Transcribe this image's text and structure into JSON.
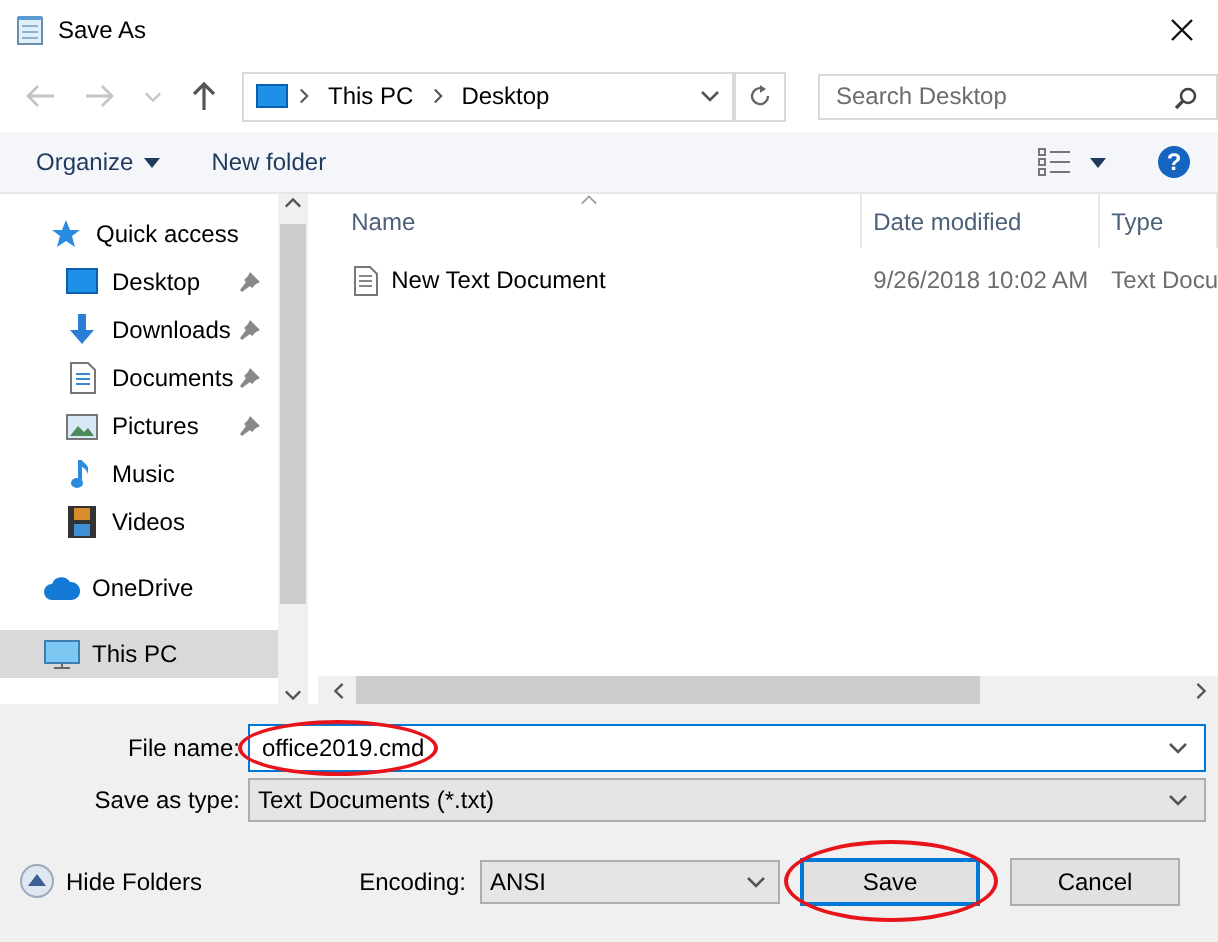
{
  "window": {
    "title": "Save As"
  },
  "nav_buttons": [
    {
      "kind": "back",
      "disabled": true
    },
    {
      "kind": "forward",
      "disabled": true
    },
    {
      "kind": "recent",
      "disabled": true
    },
    {
      "kind": "up",
      "disabled": false
    }
  ],
  "address": {
    "path": [
      "This PC",
      "Desktop"
    ]
  },
  "search": {
    "placeholder": "Search Desktop"
  },
  "toolbar": {
    "buttons": [
      {
        "label": "Organize",
        "menu": true
      },
      {
        "label": "New folder",
        "menu": false
      }
    ],
    "help": "?"
  },
  "sidebar": {
    "items": [
      {
        "label": "Quick access",
        "kind": "star",
        "selected": false,
        "children": [
          {
            "label": "Desktop",
            "kind": "desktop",
            "pinned": true,
            "selected": false
          },
          {
            "label": "Downloads",
            "kind": "download",
            "pinned": true,
            "selected": false
          },
          {
            "label": "Documents",
            "kind": "document",
            "pinned": true,
            "selected": false
          },
          {
            "label": "Pictures",
            "kind": "picture",
            "pinned": true,
            "selected": false
          },
          {
            "label": "Music",
            "kind": "music",
            "pinned": false,
            "selected": false
          },
          {
            "label": "Videos",
            "kind": "film",
            "pinned": false,
            "selected": false
          }
        ]
      },
      {
        "label": "OneDrive",
        "kind": "cloud",
        "selected": false
      },
      {
        "label": "This PC",
        "kind": "pc",
        "selected": true
      }
    ]
  },
  "table": {
    "columns": [
      {
        "label": "Name",
        "sorted": true
      },
      {
        "label": "Date modified",
        "sorted": false
      },
      {
        "label": "Type",
        "sorted": false
      }
    ],
    "rows": [
      {
        "cells": [
          "New Text Document",
          "9/26/2018 10:02 AM",
          "Text Docu"
        ]
      }
    ]
  },
  "footer": {
    "file_name": {
      "label": "File name:",
      "value": "office2019.cmd",
      "circled": true
    },
    "save_as_type": {
      "label": "Save as type:",
      "value": "Text Documents (*.txt)"
    },
    "hide_folders": "Hide Folders",
    "encoding": {
      "label": "Encoding:",
      "value": "ANSI"
    },
    "buttons": [
      {
        "label": "Save",
        "default": true,
        "circled": true
      },
      {
        "label": "Cancel",
        "default": false,
        "circled": false
      }
    ]
  }
}
